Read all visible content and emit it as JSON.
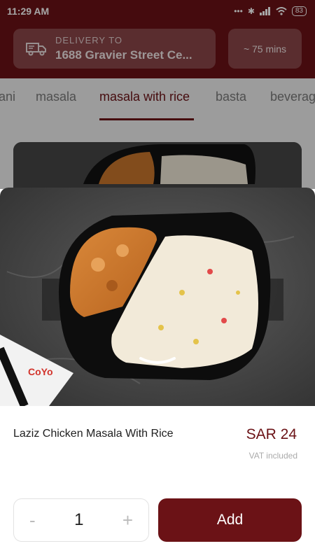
{
  "status": {
    "time": "11:29 AM",
    "battery": "83"
  },
  "header": {
    "delivery_label": "DELIVERY TO",
    "address": "1688 Gravier Street Ce...",
    "eta": "~ 75 mins"
  },
  "tabs": [
    "ani",
    "masala",
    "masala with rice",
    "basta",
    "beverag"
  ],
  "active_tab": "masala with rice",
  "item": {
    "name": "Laziz Chicken Masala With Rice",
    "price": "SAR 24",
    "vat_note": "VAT included",
    "quantity": "1",
    "minus": "-",
    "plus": "+",
    "add_label": "Add",
    "napkin_logo": "CoYo"
  },
  "colors": {
    "brand": "#6b1216",
    "tab_bg": "#f0f0f0"
  }
}
